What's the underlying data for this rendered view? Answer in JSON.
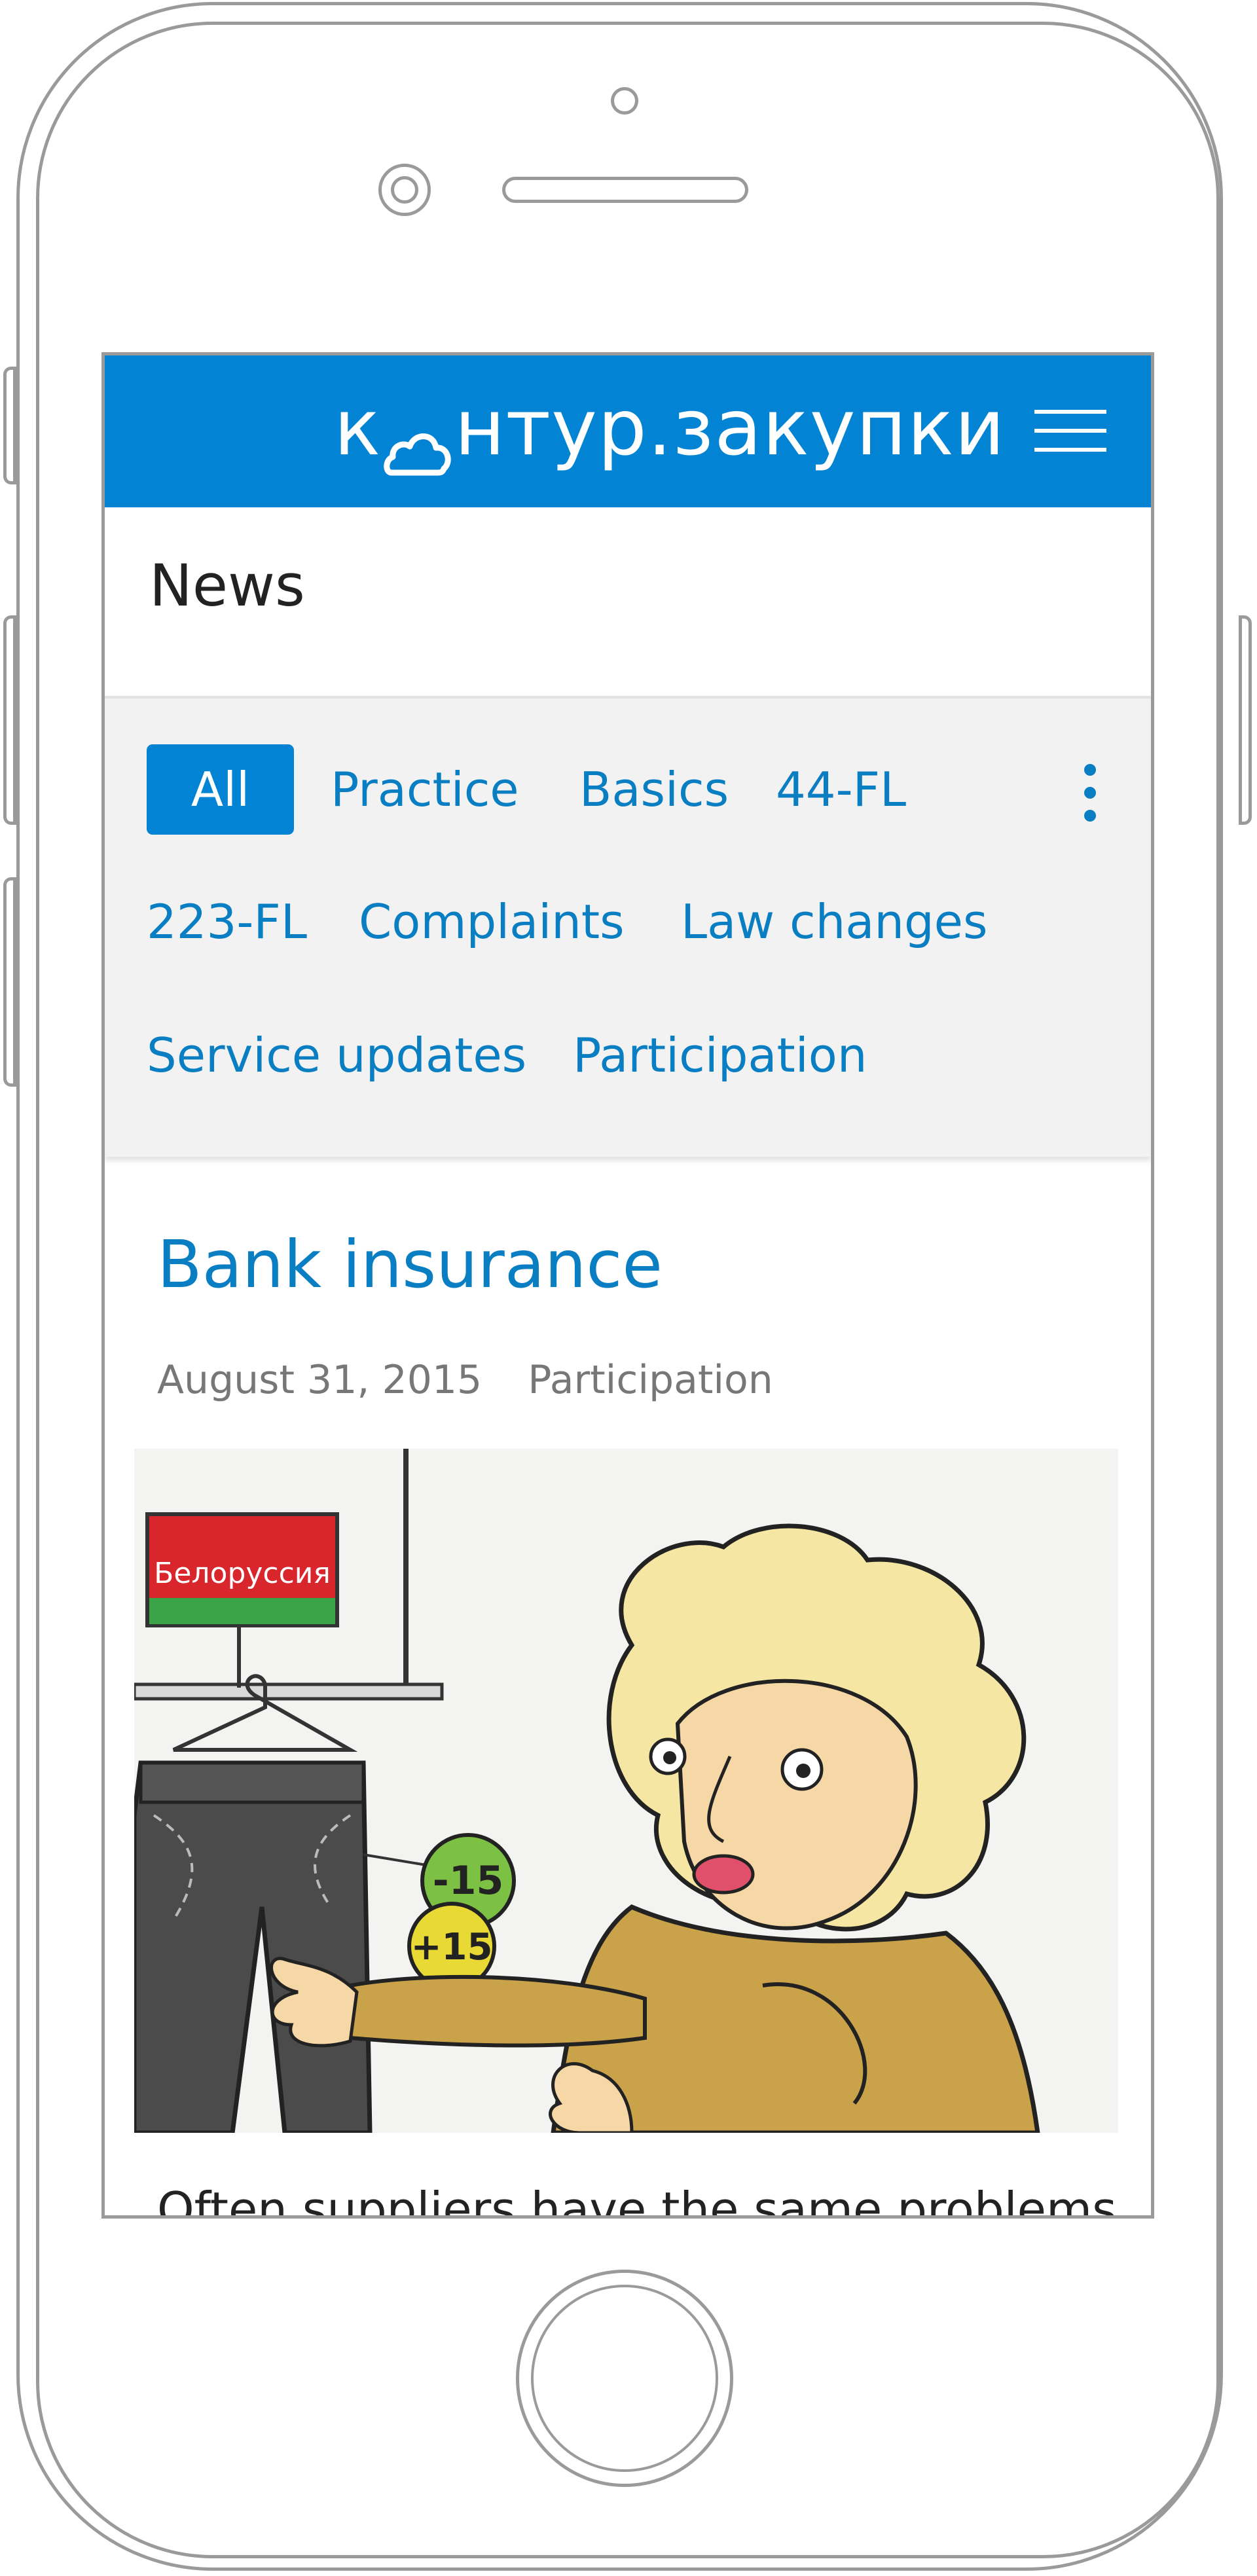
{
  "header": {
    "logo_prefix": "к",
    "logo_suffix": "нтур.закупки",
    "brand_color": "#0283d4",
    "menu_icon": "hamburger-menu-icon"
  },
  "page": {
    "title": "News"
  },
  "filters": {
    "items": [
      "All",
      "Practice",
      "Basics",
      "44-FL",
      "223-FL",
      "Complaints",
      "Law changes",
      "Service updates",
      "Participation"
    ],
    "active": "All",
    "more_icon": "vertical-dots-icon"
  },
  "article": {
    "title": "Bank insurance",
    "date": "August 31, 2015",
    "category": "Participation",
    "image": {
      "sign_text": "Белоруссия",
      "tag_green": "-15",
      "tag_yellow": "+15"
    },
    "excerpt": "Often suppliers have the same problems"
  },
  "colors": {
    "link": "#0a7ec2",
    "panel_bg": "#f2f2f2",
    "frame": "#9a9a9a"
  }
}
